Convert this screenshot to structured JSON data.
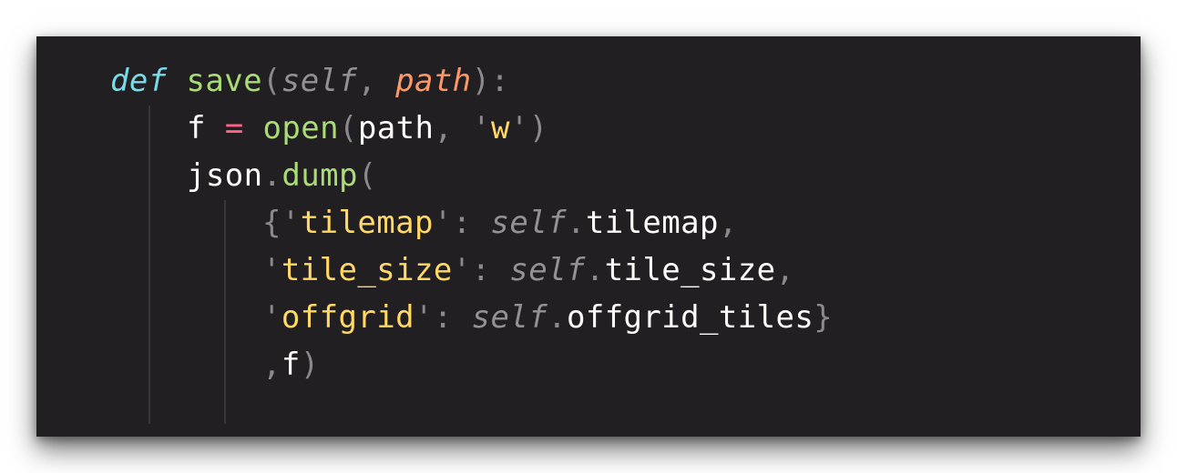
{
  "editor": {
    "background": "#221f22",
    "theme_colors": {
      "keyword": "#78dce8",
      "function": "#a9dc76",
      "string": "#ffd866",
      "operator": "#ff6188",
      "parameter": "#fc9867",
      "punctuation": "#8b888f",
      "self": "#939293",
      "text": "#fcfcfa"
    },
    "lines": [
      {
        "tokens": [
          {
            "text": "def",
            "kind": "kw"
          },
          {
            "text": " ",
            "kind": "plain"
          },
          {
            "text": "save",
            "kind": "fn"
          },
          {
            "text": "(",
            "kind": "punc"
          },
          {
            "text": "self",
            "kind": "selfkw"
          },
          {
            "text": ", ",
            "kind": "punc"
          },
          {
            "text": "path",
            "kind": "param"
          },
          {
            "text": "):",
            "kind": "punc"
          }
        ]
      },
      {
        "tokens": [
          {
            "text": "f",
            "kind": "plain"
          },
          {
            "text": " ",
            "kind": "plain"
          },
          {
            "text": "=",
            "kind": "op"
          },
          {
            "text": " ",
            "kind": "plain"
          },
          {
            "text": "open",
            "kind": "fn"
          },
          {
            "text": "(",
            "kind": "punc"
          },
          {
            "text": "path",
            "kind": "plain"
          },
          {
            "text": ", ",
            "kind": "punc"
          },
          {
            "text": "'",
            "kind": "punc"
          },
          {
            "text": "w",
            "kind": "str"
          },
          {
            "text": "'",
            "kind": "punc"
          },
          {
            "text": ")",
            "kind": "punc"
          }
        ]
      },
      {
        "tokens": [
          {
            "text": "json",
            "kind": "plain"
          },
          {
            "text": ".",
            "kind": "punc"
          },
          {
            "text": "dump",
            "kind": "fn"
          },
          {
            "text": "(",
            "kind": "punc"
          }
        ]
      },
      {
        "tokens": [
          {
            "text": "{",
            "kind": "punc"
          },
          {
            "text": "'",
            "kind": "punc"
          },
          {
            "text": "tilemap",
            "kind": "str"
          },
          {
            "text": "'",
            "kind": "punc"
          },
          {
            "text": ": ",
            "kind": "punc"
          },
          {
            "text": "self",
            "kind": "selfkw"
          },
          {
            "text": ".",
            "kind": "punc"
          },
          {
            "text": "tilemap",
            "kind": "plain"
          },
          {
            "text": ",",
            "kind": "punc"
          }
        ]
      },
      {
        "tokens": [
          {
            "text": "'",
            "kind": "punc"
          },
          {
            "text": "tile_size",
            "kind": "str"
          },
          {
            "text": "'",
            "kind": "punc"
          },
          {
            "text": ": ",
            "kind": "punc"
          },
          {
            "text": "self",
            "kind": "selfkw"
          },
          {
            "text": ".",
            "kind": "punc"
          },
          {
            "text": "tile_size",
            "kind": "plain"
          },
          {
            "text": ",",
            "kind": "punc"
          }
        ]
      },
      {
        "tokens": [
          {
            "text": "'",
            "kind": "punc"
          },
          {
            "text": "offgrid",
            "kind": "str"
          },
          {
            "text": "'",
            "kind": "punc"
          },
          {
            "text": ": ",
            "kind": "punc"
          },
          {
            "text": "self",
            "kind": "selfkw"
          },
          {
            "text": ".",
            "kind": "punc"
          },
          {
            "text": "offgrid_tiles",
            "kind": "plain"
          },
          {
            "text": "}",
            "kind": "punc"
          }
        ]
      },
      {
        "tokens": [
          {
            "text": ",",
            "kind": "punc"
          },
          {
            "text": "f",
            "kind": "plain"
          },
          {
            "text": ")",
            "kind": "punc"
          }
        ]
      }
    ]
  }
}
